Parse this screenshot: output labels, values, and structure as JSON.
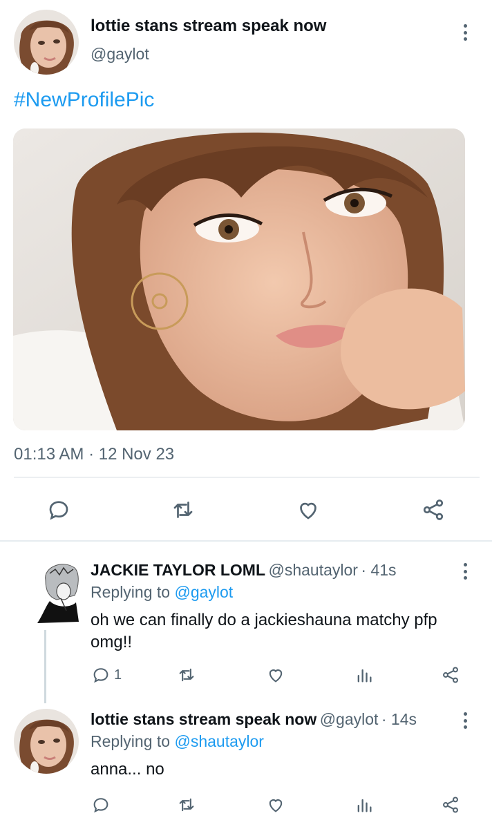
{
  "main_tweet": {
    "author_name": "lottie stans stream speak now",
    "author_handle": "@gaylot",
    "text": "#NewProfilePic",
    "timestamp": "01:13 AM · 12 Nov 23",
    "actions": [
      "reply-icon",
      "retweet-icon",
      "like-icon",
      "share-icon"
    ]
  },
  "replies": [
    {
      "author_name": "JACKIE TAYLOR LOML",
      "author_handle": "@shautaylor",
      "time": "· 41s",
      "replying_prefix": "Replying to",
      "replying_to": "@gaylot",
      "text": "oh we can finally do a jackieshauna matchy pfp omg!!",
      "reply_count": "1"
    },
    {
      "author_name": "lottie stans stream speak now",
      "author_handle": "@gaylot",
      "time": "· 14s",
      "replying_prefix": "Replying to",
      "replying_to": "@shautaylor",
      "text": "anna... no",
      "reply_count": ""
    }
  ],
  "colors": {
    "accent": "#1d9bf0",
    "text": "#0f1419",
    "muted": "#536471",
    "divider": "#eceff1"
  }
}
